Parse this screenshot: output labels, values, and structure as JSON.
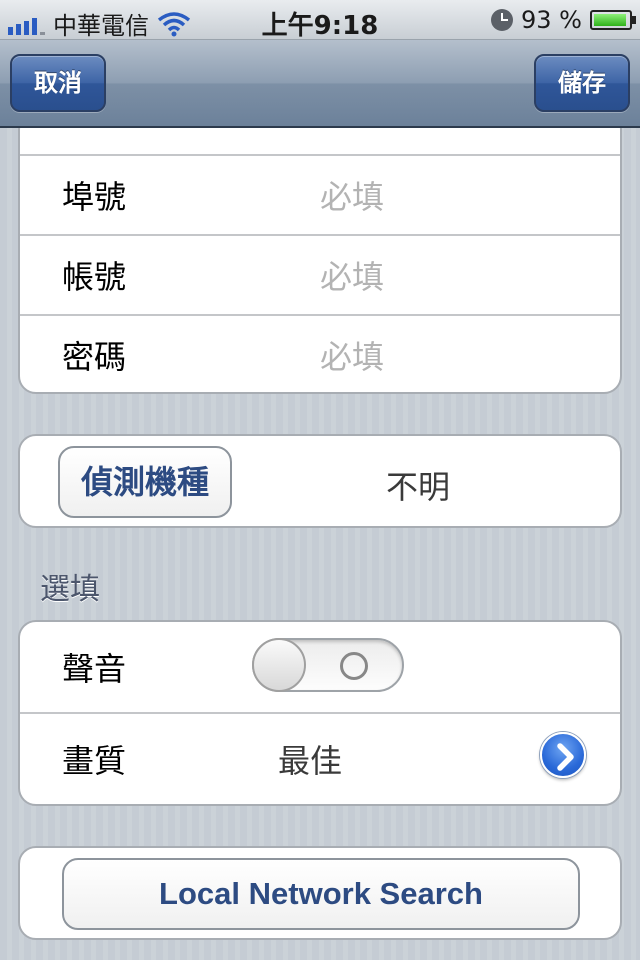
{
  "status_bar": {
    "carrier": "中華電信",
    "time": "上午9:18",
    "battery": "93 %",
    "battery_level": 0.93
  },
  "nav_bar": {
    "cancel_label": "取消",
    "save_label": "儲存"
  },
  "account_group": {
    "rows": [
      {
        "label": "埠號",
        "placeholder": "必填"
      },
      {
        "label": "帳號",
        "placeholder": "必填"
      },
      {
        "label": "密碼",
        "placeholder": "必填"
      }
    ]
  },
  "device_group": {
    "detect_label": "偵測機種",
    "model_value": "不明"
  },
  "optional_section": {
    "header": "選填",
    "sound_label": "聲音",
    "sound_on": false,
    "quality_label": "畫質",
    "quality_value": "最佳"
  },
  "search_group": {
    "button_label": "Local Network Search"
  }
}
